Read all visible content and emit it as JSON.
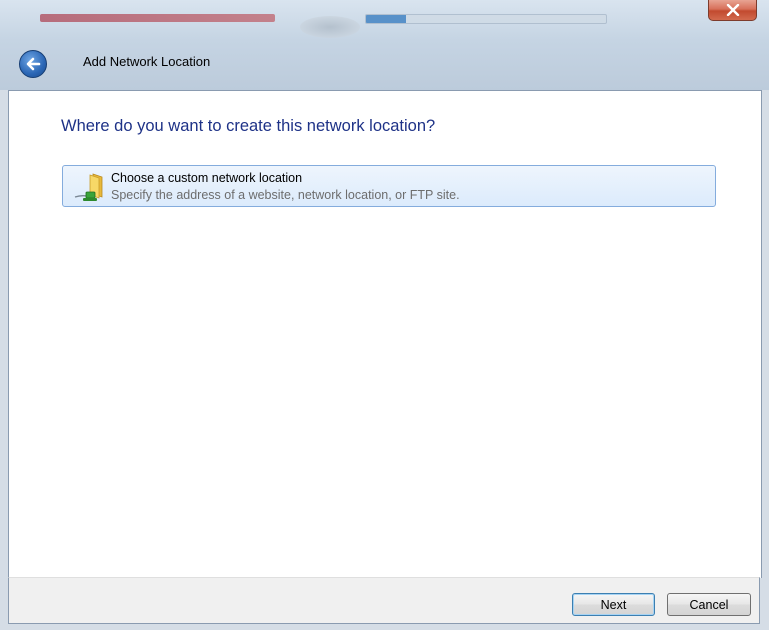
{
  "window": {
    "title": "Add Network Location",
    "close_icon": "close-icon",
    "back_icon": "back-arrow-icon"
  },
  "main": {
    "heading": "Where do you want to create this network location?",
    "options": [
      {
        "icon": "network-folder-icon",
        "label": "Choose a custom network location",
        "description": "Specify the address of a website, network location, or FTP site."
      }
    ]
  },
  "footer": {
    "next_label": "Next",
    "cancel_label": "Cancel"
  },
  "colors": {
    "heading": "#1e3287",
    "option_border": "#84acdd",
    "close_button": "#c24a2f"
  }
}
